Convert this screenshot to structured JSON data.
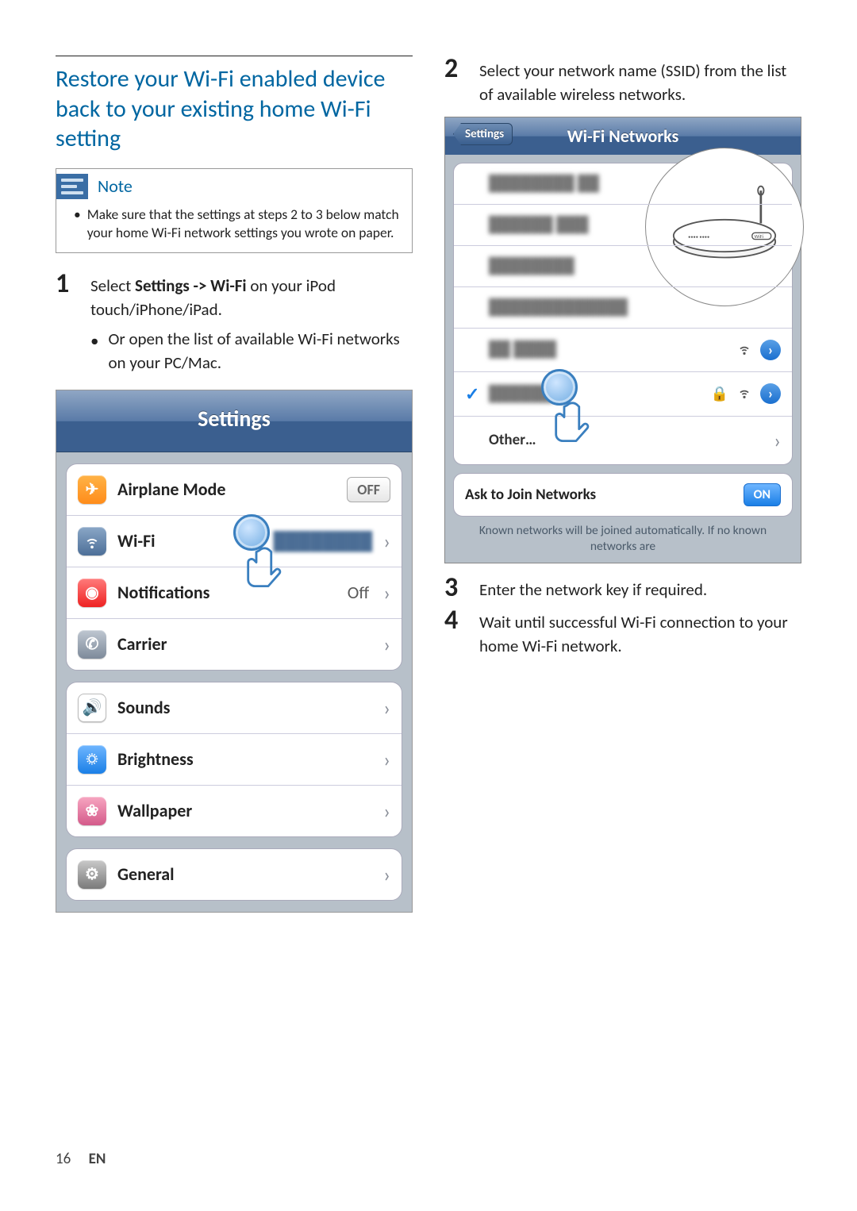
{
  "left": {
    "title": "Restore your Wi-Fi enabled device back to your existing home Wi-Fi setting",
    "note_label": "Note",
    "note_text": "Make sure that the settings at steps 2 to 3 below match your home Wi-Fi network settings you wrote on paper.",
    "step1_num": "1",
    "step1_a": "Select ",
    "step1_b": "Settings -> Wi-Fi",
    "step1_c": " on your iPod touch/iPhone/iPad.",
    "step1_sub": "Or open the list of available Wi-Fi networks on your PC/Mac.",
    "settings_title": "Settings",
    "rows": {
      "airplane": "Airplane Mode",
      "airplane_off": "OFF",
      "wifi": "Wi-Fi",
      "wifi_value": "████████",
      "notifications": "Notifications",
      "notifications_off": "Off",
      "carrier": "Carrier",
      "sounds": "Sounds",
      "brightness": "Brightness",
      "wallpaper": "Wallpaper",
      "general": "General"
    }
  },
  "right": {
    "step2_num": "2",
    "step2_text": "Select your network name (SSID) from the list of available wireless networks.",
    "step3_num": "3",
    "step3_text": "Enter the network key if required.",
    "step4_num": "4",
    "step4_text": "Wait until successful Wi-Fi connection to your home Wi-Fi network.",
    "wifi": {
      "back": "Settings",
      "title": "Wi-Fi Networks",
      "other": "Other…",
      "ask_label": "Ask to Join Networks",
      "ask_on": "ON",
      "help": "Known networks will be joined automatically.  If no known networks are",
      "networks": [
        {
          "name": "████████ ██"
        },
        {
          "name": "██████ ███"
        },
        {
          "name": "████████"
        },
        {
          "name": "█████████████"
        },
        {
          "name": "██ ████",
          "signal": true,
          "info": true
        },
        {
          "name": "██████ █",
          "checked": true,
          "lock": true,
          "signal": true,
          "info": true
        }
      ]
    }
  },
  "footer": {
    "page": "16",
    "lang": "EN"
  }
}
